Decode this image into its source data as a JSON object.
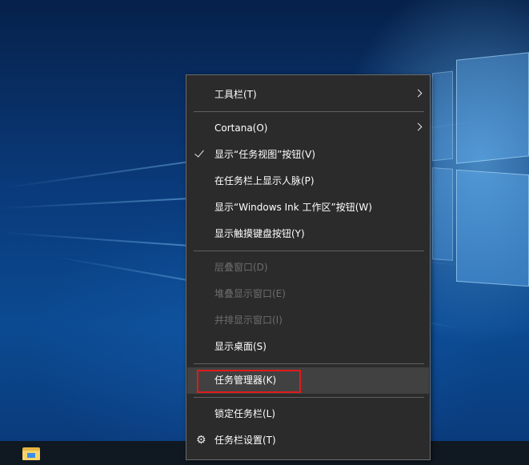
{
  "menu": {
    "items": [
      {
        "label": "工具栏(T)"
      },
      {
        "label": "Cortana(O)"
      },
      {
        "label": "显示“任务视图”按钮(V)"
      },
      {
        "label": "在任务栏上显示人脉(P)"
      },
      {
        "label": "显示“Windows Ink 工作区”按钮(W)"
      },
      {
        "label": "显示触摸键盘按钮(Y)"
      },
      {
        "label": "层叠窗口(D)"
      },
      {
        "label": "堆叠显示窗口(E)"
      },
      {
        "label": "并排显示窗口(I)"
      },
      {
        "label": "显示桌面(S)"
      },
      {
        "label": "任务管理器(K)"
      },
      {
        "label": "锁定任务栏(L)"
      },
      {
        "label": "任务栏设置(T)"
      }
    ],
    "disabled_color": "#6d6d6d",
    "highlight_color": "#e11b1b"
  },
  "taskbar": {
    "pinned_icons": [
      "file-explorer-icon"
    ]
  }
}
